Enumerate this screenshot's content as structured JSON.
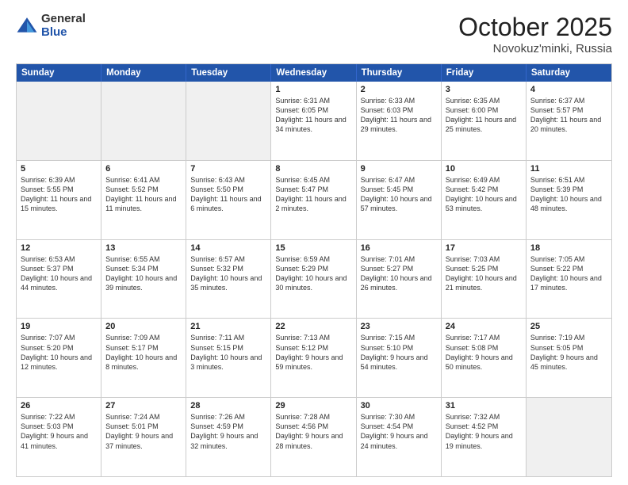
{
  "logo": {
    "general": "General",
    "blue": "Blue"
  },
  "title": "October 2025",
  "subtitle": "Novokuz'minki, Russia",
  "headers": [
    "Sunday",
    "Monday",
    "Tuesday",
    "Wednesday",
    "Thursday",
    "Friday",
    "Saturday"
  ],
  "rows": [
    [
      {
        "day": "",
        "text": "",
        "shaded": true
      },
      {
        "day": "",
        "text": "",
        "shaded": true
      },
      {
        "day": "",
        "text": "",
        "shaded": true
      },
      {
        "day": "1",
        "text": "Sunrise: 6:31 AM\nSunset: 6:05 PM\nDaylight: 11 hours\nand 34 minutes.",
        "shaded": false
      },
      {
        "day": "2",
        "text": "Sunrise: 6:33 AM\nSunset: 6:03 PM\nDaylight: 11 hours\nand 29 minutes.",
        "shaded": false
      },
      {
        "day": "3",
        "text": "Sunrise: 6:35 AM\nSunset: 6:00 PM\nDaylight: 11 hours\nand 25 minutes.",
        "shaded": false
      },
      {
        "day": "4",
        "text": "Sunrise: 6:37 AM\nSunset: 5:57 PM\nDaylight: 11 hours\nand 20 minutes.",
        "shaded": false
      }
    ],
    [
      {
        "day": "5",
        "text": "Sunrise: 6:39 AM\nSunset: 5:55 PM\nDaylight: 11 hours\nand 15 minutes.",
        "shaded": false
      },
      {
        "day": "6",
        "text": "Sunrise: 6:41 AM\nSunset: 5:52 PM\nDaylight: 11 hours\nand 11 minutes.",
        "shaded": false
      },
      {
        "day": "7",
        "text": "Sunrise: 6:43 AM\nSunset: 5:50 PM\nDaylight: 11 hours\nand 6 minutes.",
        "shaded": false
      },
      {
        "day": "8",
        "text": "Sunrise: 6:45 AM\nSunset: 5:47 PM\nDaylight: 11 hours\nand 2 minutes.",
        "shaded": false
      },
      {
        "day": "9",
        "text": "Sunrise: 6:47 AM\nSunset: 5:45 PM\nDaylight: 10 hours\nand 57 minutes.",
        "shaded": false
      },
      {
        "day": "10",
        "text": "Sunrise: 6:49 AM\nSunset: 5:42 PM\nDaylight: 10 hours\nand 53 minutes.",
        "shaded": false
      },
      {
        "day": "11",
        "text": "Sunrise: 6:51 AM\nSunset: 5:39 PM\nDaylight: 10 hours\nand 48 minutes.",
        "shaded": false
      }
    ],
    [
      {
        "day": "12",
        "text": "Sunrise: 6:53 AM\nSunset: 5:37 PM\nDaylight: 10 hours\nand 44 minutes.",
        "shaded": false
      },
      {
        "day": "13",
        "text": "Sunrise: 6:55 AM\nSunset: 5:34 PM\nDaylight: 10 hours\nand 39 minutes.",
        "shaded": false
      },
      {
        "day": "14",
        "text": "Sunrise: 6:57 AM\nSunset: 5:32 PM\nDaylight: 10 hours\nand 35 minutes.",
        "shaded": false
      },
      {
        "day": "15",
        "text": "Sunrise: 6:59 AM\nSunset: 5:29 PM\nDaylight: 10 hours\nand 30 minutes.",
        "shaded": false
      },
      {
        "day": "16",
        "text": "Sunrise: 7:01 AM\nSunset: 5:27 PM\nDaylight: 10 hours\nand 26 minutes.",
        "shaded": false
      },
      {
        "day": "17",
        "text": "Sunrise: 7:03 AM\nSunset: 5:25 PM\nDaylight: 10 hours\nand 21 minutes.",
        "shaded": false
      },
      {
        "day": "18",
        "text": "Sunrise: 7:05 AM\nSunset: 5:22 PM\nDaylight: 10 hours\nand 17 minutes.",
        "shaded": false
      }
    ],
    [
      {
        "day": "19",
        "text": "Sunrise: 7:07 AM\nSunset: 5:20 PM\nDaylight: 10 hours\nand 12 minutes.",
        "shaded": false
      },
      {
        "day": "20",
        "text": "Sunrise: 7:09 AM\nSunset: 5:17 PM\nDaylight: 10 hours\nand 8 minutes.",
        "shaded": false
      },
      {
        "day": "21",
        "text": "Sunrise: 7:11 AM\nSunset: 5:15 PM\nDaylight: 10 hours\nand 3 minutes.",
        "shaded": false
      },
      {
        "day": "22",
        "text": "Sunrise: 7:13 AM\nSunset: 5:12 PM\nDaylight: 9 hours\nand 59 minutes.",
        "shaded": false
      },
      {
        "day": "23",
        "text": "Sunrise: 7:15 AM\nSunset: 5:10 PM\nDaylight: 9 hours\nand 54 minutes.",
        "shaded": false
      },
      {
        "day": "24",
        "text": "Sunrise: 7:17 AM\nSunset: 5:08 PM\nDaylight: 9 hours\nand 50 minutes.",
        "shaded": false
      },
      {
        "day": "25",
        "text": "Sunrise: 7:19 AM\nSunset: 5:05 PM\nDaylight: 9 hours\nand 45 minutes.",
        "shaded": false
      }
    ],
    [
      {
        "day": "26",
        "text": "Sunrise: 7:22 AM\nSunset: 5:03 PM\nDaylight: 9 hours\nand 41 minutes.",
        "shaded": false
      },
      {
        "day": "27",
        "text": "Sunrise: 7:24 AM\nSunset: 5:01 PM\nDaylight: 9 hours\nand 37 minutes.",
        "shaded": false
      },
      {
        "day": "28",
        "text": "Sunrise: 7:26 AM\nSunset: 4:59 PM\nDaylight: 9 hours\nand 32 minutes.",
        "shaded": false
      },
      {
        "day": "29",
        "text": "Sunrise: 7:28 AM\nSunset: 4:56 PM\nDaylight: 9 hours\nand 28 minutes.",
        "shaded": false
      },
      {
        "day": "30",
        "text": "Sunrise: 7:30 AM\nSunset: 4:54 PM\nDaylight: 9 hours\nand 24 minutes.",
        "shaded": false
      },
      {
        "day": "31",
        "text": "Sunrise: 7:32 AM\nSunset: 4:52 PM\nDaylight: 9 hours\nand 19 minutes.",
        "shaded": false
      },
      {
        "day": "",
        "text": "",
        "shaded": true
      }
    ]
  ]
}
